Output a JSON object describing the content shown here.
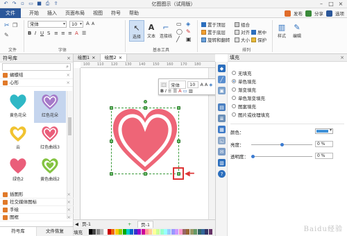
{
  "window": {
    "title": "亿图图示（试用版）",
    "controls": [
      "–",
      "□",
      "×"
    ]
  },
  "menu": {
    "file": "文件",
    "items": [
      "开始",
      "插入",
      "页面布局",
      "视图",
      "符号",
      "帮助"
    ],
    "right": [
      "发布",
      "分享",
      "选项"
    ]
  },
  "ribbon": {
    "font_name": "宋体",
    "font_size": "10",
    "group_file": "文件",
    "group_font": "字体",
    "group_basic": "基本工具",
    "group_arrange": "排列",
    "select_label": "选择",
    "text_label": "文本",
    "connector_label": "连接线",
    "arrange_items": [
      "置于顶层",
      "置于底层",
      "旋转和翻转",
      "组合",
      "对齐",
      "大小",
      "居中",
      "保护"
    ],
    "style_label": "样式",
    "edit_label": "编辑"
  },
  "library": {
    "title": "符号库",
    "categories_top": [
      "蝴蝶结",
      "心形"
    ],
    "shapes": [
      {
        "label": "黄色花朵",
        "color": "#f2c23c"
      },
      {
        "label": "红色花朵",
        "color": "#e05b6b"
      },
      {
        "label": "云",
        "color": "#2fb8c6"
      },
      {
        "label": "红色曲线3",
        "color": "#a57ac9"
      },
      {
        "label": "绿色2",
        "color": "#2ec0c9"
      },
      {
        "label": "黄色曲线2",
        "color": "#f1c330"
      },
      {
        "label": "红色梳状",
        "color": "#ea5e7a"
      },
      {
        "label": "绿色3",
        "color": "#84c341"
      }
    ],
    "categories_bottom": [
      "插图形",
      "社交媒体图标",
      "手绘",
      "图框"
    ],
    "tabs": [
      "符号库",
      "文件恢复"
    ]
  },
  "canvas": {
    "doc_tabs": [
      "绘图1",
      "绘图2"
    ],
    "page_label": "页-1",
    "page_tab": "页-1",
    "fill_label": "填充",
    "ruler_marks": [
      "100",
      "110",
      "120",
      "130",
      "140",
      "150",
      "160",
      "170",
      "180"
    ]
  },
  "floatbar": {
    "font": "宋体",
    "size": "10",
    "bold": "B",
    "italic": "I"
  },
  "heart": {
    "outer_color": "#ee6577",
    "inner_color": "#ffffff"
  },
  "fill_panel": {
    "title": "填充",
    "options": [
      "无填充",
      "单色填充",
      "渐变填充",
      "单色渐变填充",
      "图案填充",
      "图片或纹理填充"
    ],
    "selected_index": 1,
    "color_label": "颜色：",
    "color_value": "#3d8fd6",
    "brightness_label": "亮度：",
    "brightness_value": "0 %",
    "transparency_label": "透明度：",
    "transparency_value": "0 %"
  },
  "watermark": "Baidu经验"
}
